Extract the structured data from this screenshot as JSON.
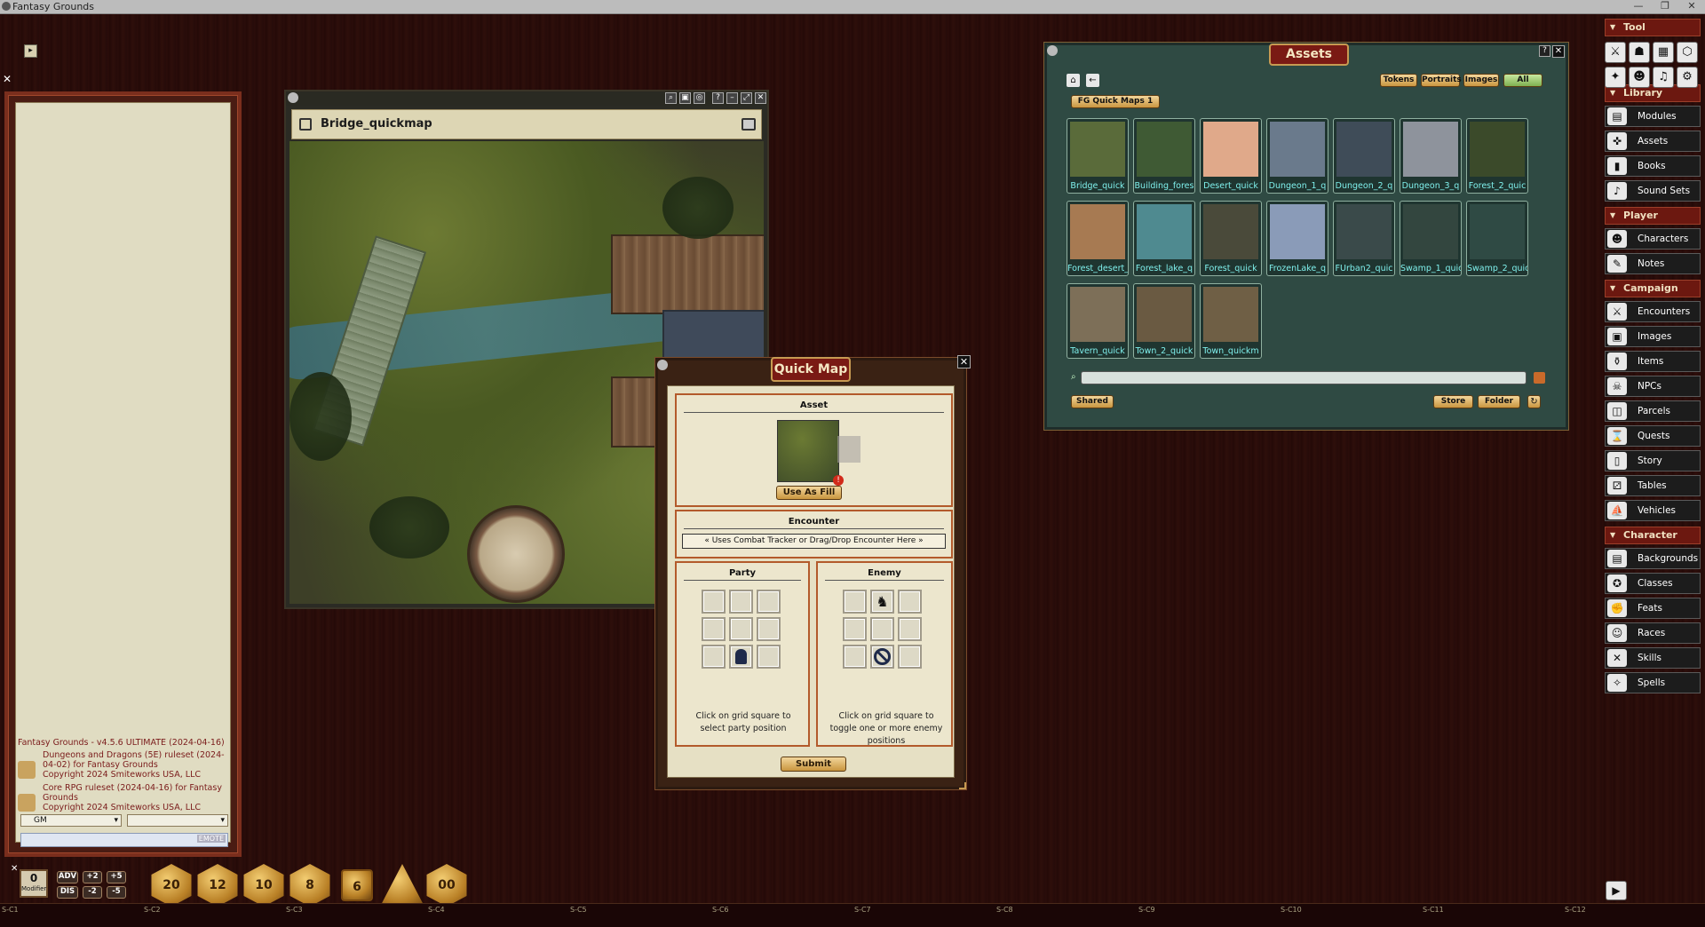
{
  "app": {
    "title": "Fantasy Grounds"
  },
  "window_controls": {
    "minimize": "—",
    "maximize": "❐",
    "close": "✕"
  },
  "chat": {
    "messages": [
      {
        "text": "Fantasy Grounds - v4.5.6 ULTIMATE (2024-04-16)"
      },
      {
        "text": "Dungeons and Dragons (5E) ruleset (2024-04-02) for Fantasy Grounds",
        "copyright": "Copyright 2024 Smiteworks USA, LLC"
      },
      {
        "text": "Core RPG ruleset (2024-04-16) for Fantasy Grounds",
        "copyright": "Copyright 2024 Smiteworks USA, LLC"
      }
    ],
    "identity": "GM",
    "mode": "",
    "input_value": "",
    "emote_label": "EMOTE"
  },
  "map_window": {
    "title": "Bridge_quickmap"
  },
  "quick_map": {
    "title": "Quick Map",
    "asset_header": "Asset",
    "use_as_fill": "Use As Fill",
    "encounter_header": "Encounter",
    "encounter_placeholder": "« Uses Combat Tracker or Drag/Drop Encounter Here »",
    "party_header": "Party",
    "enemy_header": "Enemy",
    "party_hint": "Click on grid square to select party position",
    "enemy_hint": "Click on grid square to toggle one or more enemy positions",
    "submit": "Submit"
  },
  "assets": {
    "title": "Assets",
    "filters": [
      "Tokens",
      "Portraits",
      "Images",
      "All"
    ],
    "active_filter": "All",
    "folder": "FG Quick Maps 1",
    "tiles": [
      {
        "label": "Bridge_quick",
        "color": "#5a6b3a"
      },
      {
        "label": "Building_fores",
        "color": "#3f5a34"
      },
      {
        "label": "Desert_quick",
        "color": "#e0a98a"
      },
      {
        "label": "Dungeon_1_q",
        "color": "#6a7a8c"
      },
      {
        "label": "Dungeon_2_q",
        "color": "#3f4c58"
      },
      {
        "label": "Dungeon_3_q",
        "color": "#8e939c"
      },
      {
        "label": "Forest_2_quic",
        "color": "#3b4a2a"
      },
      {
        "label": "Forest_desert_",
        "color": "#a77a52"
      },
      {
        "label": "Forest_lake_q",
        "color": "#4f8a90"
      },
      {
        "label": "Forest_quick",
        "color": "#4a4a3a"
      },
      {
        "label": "FrozenLake_q",
        "color": "#8a9bb8"
      },
      {
        "label": "FUrban2_quic",
        "color": "#3a4a4a"
      },
      {
        "label": "Swamp_1_quic",
        "color": "#33463f"
      },
      {
        "label": "Swamp_2_quic",
        "color": "#2f4a44"
      },
      {
        "label": "Tavern_quick",
        "color": "#7d6f58"
      },
      {
        "label": "Town_2_quick",
        "color": "#6a5a42"
      },
      {
        "label": "Town_quickm",
        "color": "#6f5f45"
      }
    ],
    "search_value": "",
    "shared": "Shared",
    "store": "Store",
    "folder_btn": "Folder"
  },
  "sidebar": {
    "sections": [
      {
        "title": "Tool",
        "items": []
      },
      {
        "title": "Library",
        "items": [
          "Modules",
          "Assets",
          "Books",
          "Sound Sets"
        ]
      },
      {
        "title": "Player",
        "items": [
          "Characters",
          "Notes"
        ]
      },
      {
        "title": "Campaign",
        "items": [
          "Encounters",
          "Images",
          "Items",
          "NPCs",
          "Parcels",
          "Quests",
          "Story",
          "Tables",
          "Vehicles"
        ]
      },
      {
        "title": "Character",
        "items": [
          "Backgrounds",
          "Classes",
          "Feats",
          "Races",
          "Skills",
          "Spells"
        ]
      }
    ]
  },
  "dice_bar": {
    "modifier_value": "0",
    "modifier_label": "Modifier",
    "adv": "ADV",
    "dis": "DIS",
    "plus2": "+2",
    "plus5": "+5",
    "minus2": "-2",
    "minus5": "-5",
    "dice": [
      "20",
      "12",
      "10",
      "8",
      "6",
      "",
      "00"
    ]
  },
  "ruler_labels": [
    "S-C1",
    "S-C2",
    "S-C3",
    "S-C4",
    "S-C5",
    "S-C6",
    "S-C7",
    "S-C8",
    "S-C9",
    "S-C10",
    "S-C11",
    "S-C12"
  ]
}
